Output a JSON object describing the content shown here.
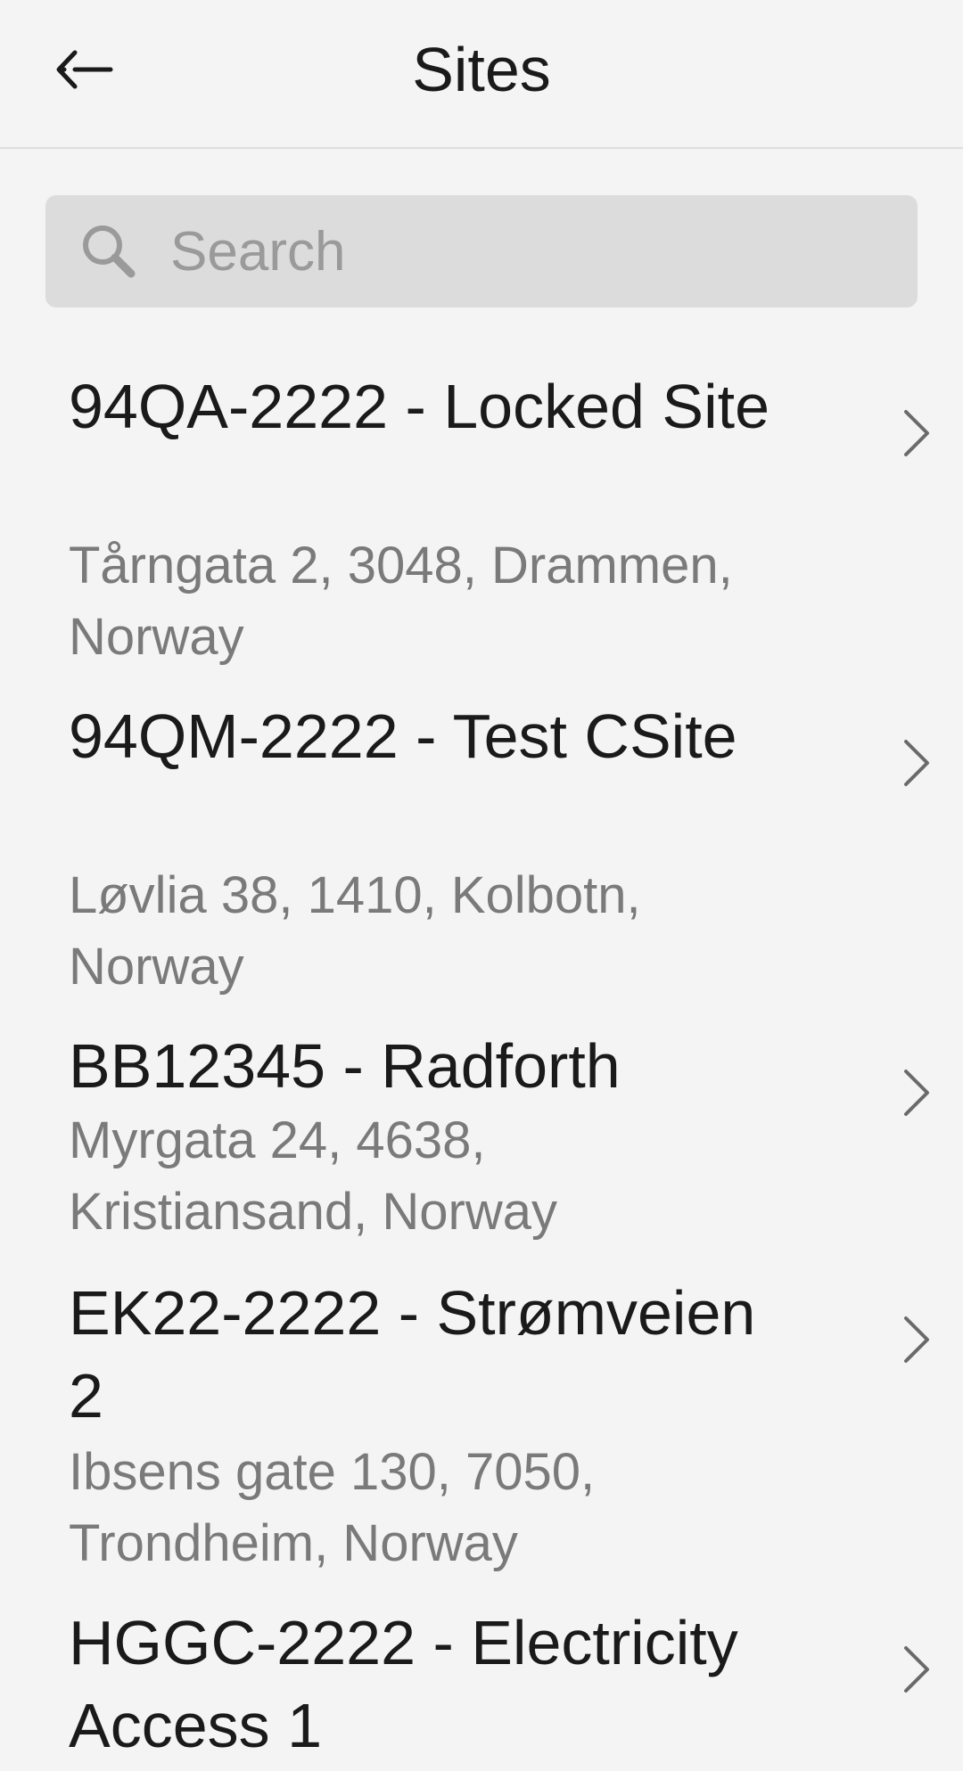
{
  "header": {
    "title": "Sites",
    "back_icon": "back-arrow-icon"
  },
  "search": {
    "placeholder": "Search",
    "value": "",
    "icon": "search-icon"
  },
  "sites": [
    {
      "name": "94QA-2222 - Locked Site",
      "address": "Tårngata 2, 3048, Drammen, Norway"
    },
    {
      "name": "94QM-2222 - Test CSite",
      "address": "Løvlia 38, 1410, Kolbotn, Norway"
    },
    {
      "name": "BB12345 - Radforth",
      "address": "Myrgata 24, 4638, Kristiansand, Norway"
    },
    {
      "name": "EK22-2222 - Strømveien 2",
      "address": "Ibsens gate 130, 7050, Trondheim, Norway"
    },
    {
      "name": "HGGC-2222 - Electricity Access 1",
      "address": ""
    }
  ],
  "colors": {
    "background": "#f4f4f4",
    "search_background": "#dcdcdc",
    "primary_text": "#1a1a1a",
    "secondary_text": "#7a7a7a"
  }
}
